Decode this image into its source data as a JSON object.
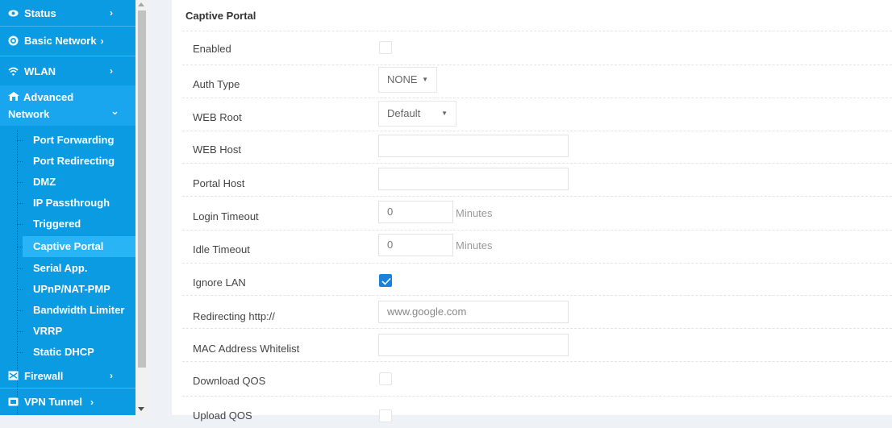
{
  "sidebar": {
    "status": "Status",
    "basic_network": "Basic Network",
    "wlan": "WLAN",
    "advanced_network_1": "Advanced",
    "advanced_network_2": "Network",
    "sub_items": [
      "Port Forwarding",
      "Port Redirecting",
      "DMZ",
      "IP Passthrough",
      "Triggered",
      "Captive Portal",
      "Serial App.",
      "UPnP/NAT-PMP",
      "Bandwidth Limiter",
      "VRRP",
      "Static DHCP"
    ],
    "active_item": "Captive Portal",
    "firewall": "Firewall",
    "vpn_tunnel": "VPN Tunnel",
    "chevron": "›",
    "chevron_down": "⌄",
    "icons": [
      "eye-icon",
      "globe-icon",
      "wifi-icon",
      "network-icon",
      "firewall-icon",
      "vpn-icon"
    ]
  },
  "panel": {
    "title": "Captive Portal",
    "labels": {
      "enabled": "Enabled",
      "auth_type": "Auth Type",
      "web_root": "WEB Root",
      "web_host": "WEB Host",
      "portal_host": "Portal Host",
      "login_timeout": "Login Timeout",
      "idle_timeout": "Idle Timeout",
      "ignore_lan": "Ignore LAN",
      "redirecting": "Redirecting http://",
      "mac_whitelist": "MAC Address Whitelist",
      "download_qos": "Download QOS",
      "upload_qos": "Upload QOS"
    },
    "values": {
      "enabled": false,
      "auth_type": "NONE",
      "web_root": "Default",
      "web_host": "",
      "portal_host": "",
      "login_timeout": "0",
      "idle_timeout": "0",
      "ignore_lan": true,
      "redirecting_placeholder": "www.google.com",
      "mac_whitelist": "",
      "download_qos": false,
      "upload_qos": false
    },
    "unit_minutes": "Minutes",
    "select_arrow": "▼"
  },
  "colors": {
    "sidebar_bg": "#0a9be3",
    "active_item": "#28b4f5",
    "checkbox_on": "#1a83d9"
  }
}
